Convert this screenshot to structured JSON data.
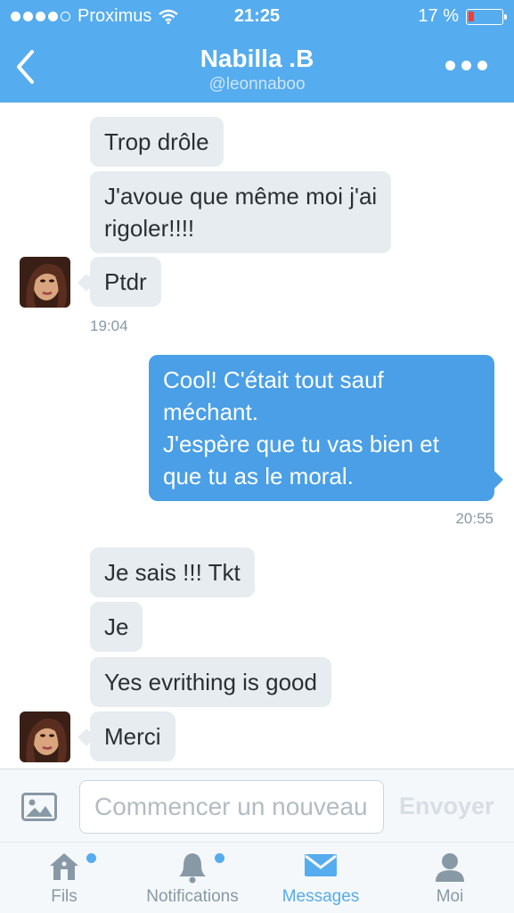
{
  "status_bar": {
    "carrier": "Proximus",
    "time": "21:25",
    "battery_text": "17 %",
    "battery_level": 0.17
  },
  "nav": {
    "title": "Nabilla .B",
    "handle": "@leonnaboo"
  },
  "messages": [
    {
      "text": "Trop drôle"
    },
    {
      "text": "J'avoue que même moi j'ai\nrigoler!!!!"
    },
    {
      "text": "Ptdr"
    },
    {
      "text": "19:04"
    },
    {
      "text": "Cool! C'était tout sauf\nméchant.\nJ'espère que tu vas bien et\nque tu as le moral."
    },
    {
      "text": "20:55"
    },
    {
      "text": "Je sais !!! Tkt"
    },
    {
      "text": "Je"
    },
    {
      "text": "Yes evrithing is good"
    },
    {
      "text": "Merci"
    }
  ],
  "compose": {
    "placeholder": "Commencer un nouveau",
    "send_label": "Envoyer"
  },
  "tabs": [
    {
      "label": "Fils"
    },
    {
      "label": "Notifications"
    },
    {
      "label": "Messages"
    },
    {
      "label": "Moi"
    }
  ],
  "colors": {
    "accent": "#55acee",
    "outgoing_bubble": "#4a9fe6",
    "incoming_bubble": "#e6ecf0"
  },
  "icons": [
    "back-chevron-icon",
    "more-dots-icon",
    "image-icon",
    "home-icon",
    "bell-icon",
    "envelope-icon",
    "person-icon"
  ]
}
